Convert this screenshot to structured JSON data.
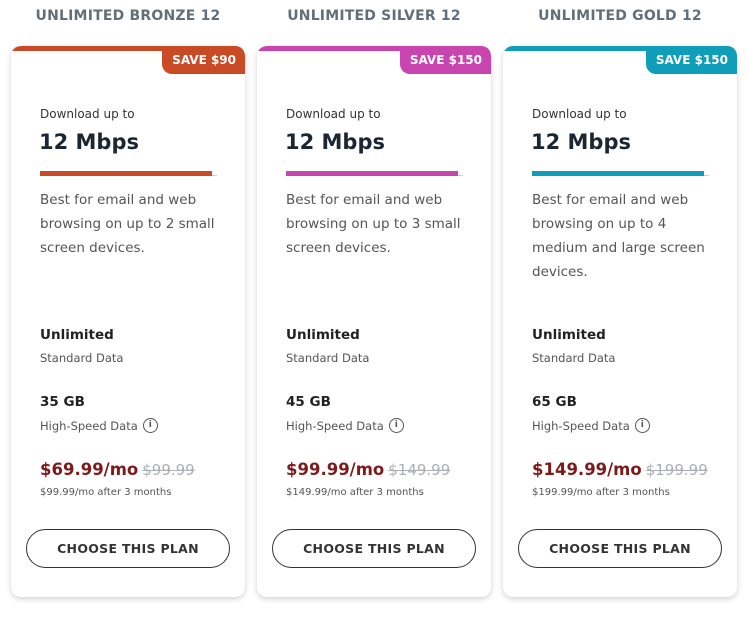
{
  "plans": [
    {
      "title": "UNLIMITED BRONZE 12",
      "badge": "SAVE $90",
      "download_label": "Download up to",
      "speed": "12 Mbps",
      "description": "Best for email and web browsing on up to 2 small screen devices.",
      "standard_value": "Unlimited",
      "standard_label": "Standard Data",
      "highspeed_value": "35 GB",
      "highspeed_label": "High-Speed Data",
      "price": "$69.99/mo",
      "old_price": "$99.99",
      "after_price": "$99.99/mo after 3 months",
      "cta": "CHOOSE THIS PLAN",
      "accent": "#c84b26",
      "speed_bar_fraction": 0.97
    },
    {
      "title": "UNLIMITED SILVER 12",
      "badge": "SAVE $150",
      "download_label": "Download up to",
      "speed": "12 Mbps",
      "description": "Best for email and web browsing on up to 3 small screen devices.",
      "standard_value": "Unlimited",
      "standard_label": "Standard Data",
      "highspeed_value": "45 GB",
      "highspeed_label": "High-Speed Data",
      "price": "$99.99/mo",
      "old_price": "$149.99",
      "after_price": "$149.99/mo after 3 months",
      "cta": "CHOOSE THIS PLAN",
      "accent": "#c845b0",
      "speed_bar_fraction": 0.97
    },
    {
      "title": "UNLIMITED GOLD 12",
      "badge": "SAVE $150",
      "download_label": "Download up to",
      "speed": "12 Mbps",
      "description": "Best for email and web browsing on up to 4 medium and large screen devices.",
      "standard_value": "Unlimited",
      "standard_label": "Standard Data",
      "highspeed_value": "65 GB",
      "highspeed_label": "High-Speed Data",
      "price": "$149.99/mo",
      "old_price": "$199.99",
      "after_price": "$199.99/mo after 3 months",
      "cta": "CHOOSE THIS PLAN",
      "accent": "#0f9db8",
      "speed_bar_fraction": 0.97
    }
  ],
  "icons": {
    "info": "info-circle-icon"
  }
}
